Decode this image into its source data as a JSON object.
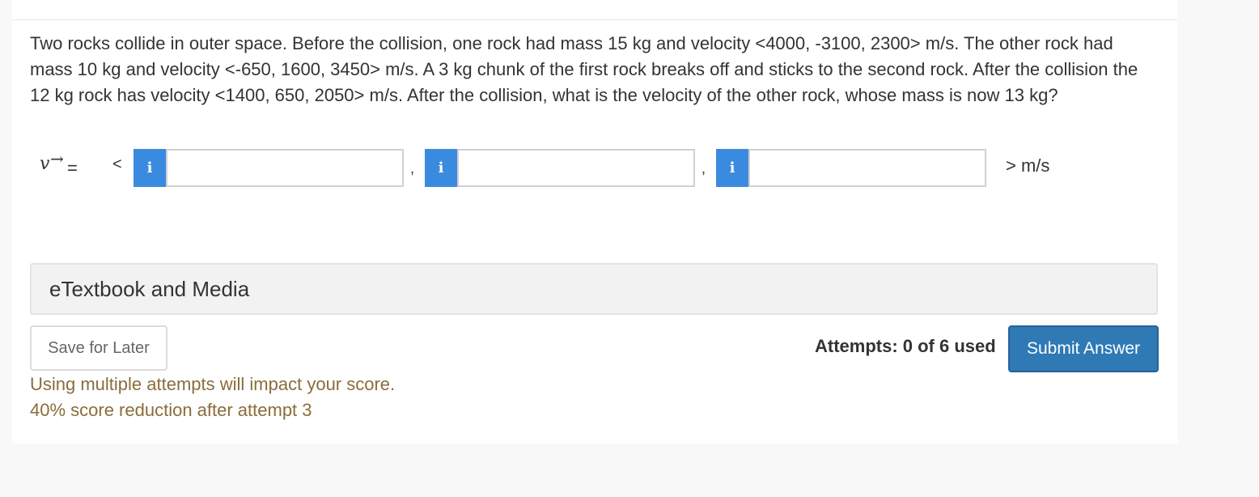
{
  "question": {
    "text": "Two rocks collide in outer space. Before the collision, one rock had mass 15 kg and velocity <4000, -3100, 2300> m/s. The other rock had mass 10 kg and velocity <-650, 1600, 3450> m/s. A 3 kg chunk of the first rock breaks off and sticks to the second rock. After the collision the 12 kg rock has velocity <1400, 650, 2050> m/s. After the collision, what is the velocity of the other rock, whose mass is now 13 kg?"
  },
  "answer": {
    "variable": "v",
    "arrow": "→",
    "equals": "=",
    "open_bracket": "<",
    "comma": ",",
    "info_label": "i",
    "inputs": [
      {
        "value": ""
      },
      {
        "value": ""
      },
      {
        "value": ""
      }
    ],
    "unit": "> m/s"
  },
  "resources": {
    "label": "eTextbook and Media"
  },
  "actions": {
    "save_label": "Save for Later",
    "attempts_text": "Attempts: 0 of 6 used",
    "submit_label": "Submit Answer"
  },
  "policy": {
    "line1": "Using multiple attempts will impact your score.",
    "line2": "40% score reduction after attempt 3"
  },
  "colors": {
    "info_button": "#3a8be0",
    "submit_button": "#2f79b5",
    "warning_text": "#8a6d3b"
  }
}
